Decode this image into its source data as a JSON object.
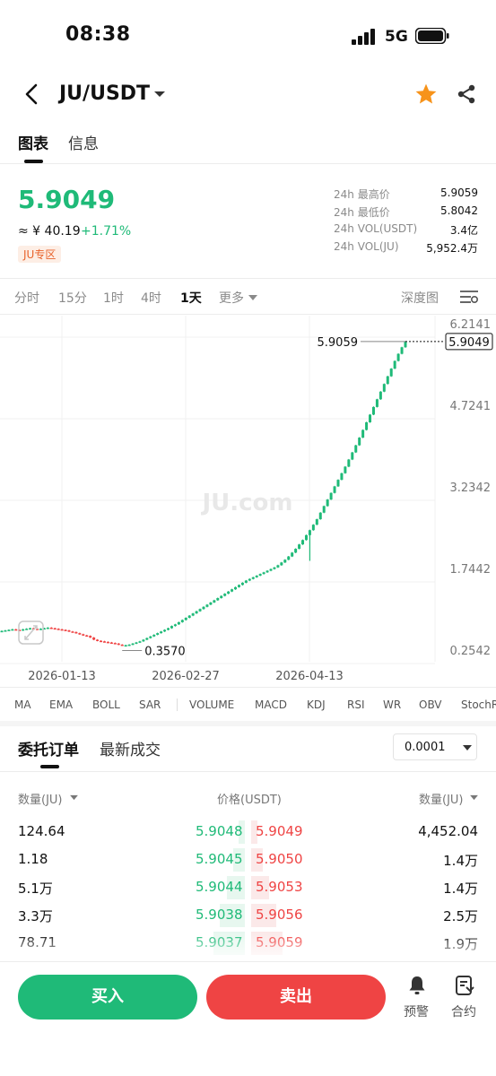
{
  "status": {
    "time": "08:38",
    "network": "5G"
  },
  "nav": {
    "pair": "JU/USDT"
  },
  "tabs": [
    "图表",
    "信息"
  ],
  "ticker": {
    "price": "5.9049",
    "fiat": "≈ ¥ 40.19",
    "change": "+1.71%",
    "zone": "JU专区",
    "stats": [
      {
        "label": "24h 最高价",
        "value": "5.9059"
      },
      {
        "label": "24h 最低价",
        "value": "5.8042"
      },
      {
        "label": "24h VOL(USDT)",
        "value": "3.4亿"
      },
      {
        "label": "24h VOL(JU)",
        "value": "5,952.4万"
      }
    ]
  },
  "intervals": [
    "分时",
    "15分",
    "1时",
    "4时",
    "1天",
    "更多"
  ],
  "active_interval": "1天",
  "depth_label": "深度图",
  "watermark": "JU.com",
  "chart_data": {
    "type": "candlestick",
    "y_ticks": [
      "6.2141",
      "4.7241",
      "3.2342",
      "1.7442",
      "0.2542"
    ],
    "ylim": [
      0.2542,
      6.2141
    ],
    "x_ticks": [
      "2026-01-13",
      "2026-02-27",
      "2026-04-13"
    ],
    "current_price": "5.9049",
    "high_label": "5.9059",
    "low_label": "0.3570",
    "colors": {
      "up": "#1fba78",
      "down": "#ef4444"
    },
    "close_series": [
      0.62,
      0.63,
      0.64,
      0.65,
      0.64,
      0.63,
      0.65,
      0.66,
      0.67,
      0.66,
      0.65,
      0.66,
      0.67,
      0.68,
      0.67,
      0.66,
      0.65,
      0.64,
      0.63,
      0.61,
      0.6,
      0.58,
      0.56,
      0.54,
      0.53,
      0.5,
      0.46,
      0.44,
      0.43,
      0.42,
      0.41,
      0.4,
      0.39,
      0.37,
      0.36,
      0.36,
      0.37,
      0.39,
      0.41,
      0.43,
      0.46,
      0.49,
      0.52,
      0.55,
      0.58,
      0.61,
      0.64,
      0.67,
      0.71,
      0.74,
      0.78,
      0.82,
      0.86,
      0.9,
      0.94,
      0.98,
      1.02,
      1.06,
      1.1,
      1.14,
      1.18,
      1.22,
      1.26,
      1.3,
      1.34,
      1.38,
      1.42,
      1.46,
      1.5,
      1.54,
      1.57,
      1.6,
      1.63,
      1.66,
      1.69,
      1.72,
      1.75,
      1.78,
      1.82,
      1.87,
      1.92,
      1.98,
      2.05,
      2.12,
      2.2,
      2.28,
      2.37,
      2.46,
      2.56,
      2.66,
      2.78,
      2.9,
      3.02,
      3.14,
      3.26,
      3.38,
      3.5,
      3.62,
      3.75,
      3.88,
      4.01,
      4.15,
      4.29,
      4.43,
      4.57,
      4.71,
      4.85,
      4.99,
      5.13,
      5.27,
      5.41,
      5.55,
      5.68,
      5.8,
      5.9049
    ]
  },
  "indicators": [
    "MA",
    "EMA",
    "BOLL",
    "SAR",
    "VOLUME",
    "MACD",
    "KDJ",
    "RSI",
    "WR",
    "OBV",
    "StochRSI"
  ],
  "orderbook": {
    "tabs": [
      "委托订单",
      "最新成交"
    ],
    "precision": "0.0001",
    "head_left": "数量(JU)",
    "head_mid": "价格(USDT)",
    "head_right": "数量(JU)",
    "rows": [
      {
        "bid_qty": "124.64",
        "bid": "5.9048",
        "ask": "5.9049",
        "ask_qty": "4,452.04"
      },
      {
        "bid_qty": "1.18",
        "bid": "5.9045",
        "ask": "5.9050",
        "ask_qty": "1.4万"
      },
      {
        "bid_qty": "5.1万",
        "bid": "5.9044",
        "ask": "5.9053",
        "ask_qty": "1.4万"
      },
      {
        "bid_qty": "3.3万",
        "bid": "5.9038",
        "ask": "5.9056",
        "ask_qty": "2.5万"
      },
      {
        "bid_qty": "78.71",
        "bid": "5.9037",
        "ask": "5.9059",
        "ask_qty": "1.9万"
      }
    ],
    "depth_fill": [
      0.12,
      0.22,
      0.34,
      0.46,
      0.58
    ]
  },
  "bottom": {
    "buy": "买入",
    "sell": "卖出",
    "alert": "预警",
    "contract": "合约"
  }
}
